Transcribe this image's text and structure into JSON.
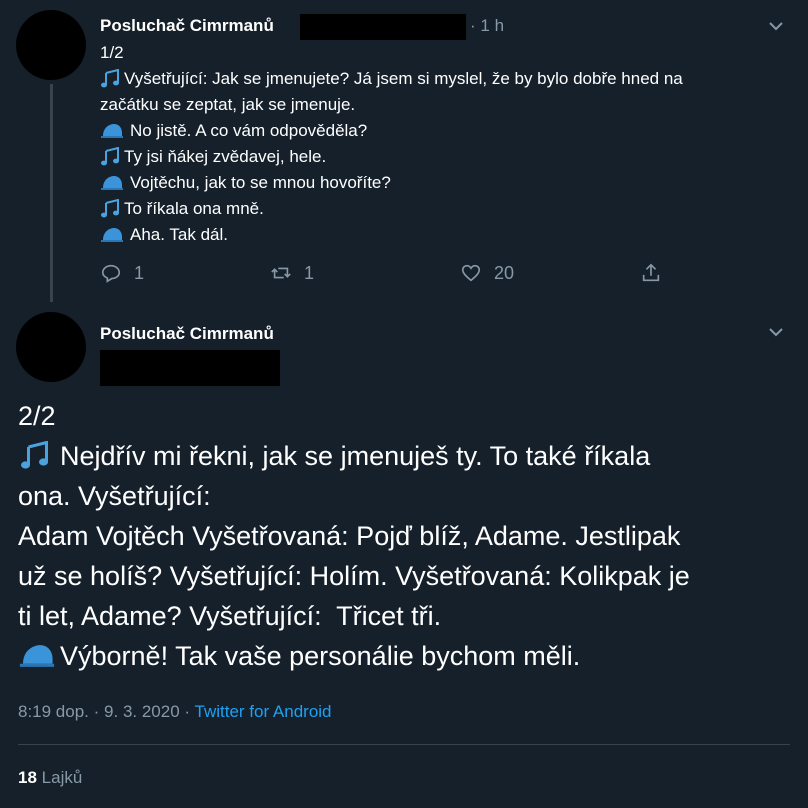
{
  "tweet1": {
    "author": "Posluchač Cimrmanů",
    "time": "1 h",
    "lines": [
      {
        "icon": "music-notes-icon",
        "text": "1/2"
      },
      {
        "icon": "music-notes-icon",
        "text": "Vyšetřující: Jak se jmenujete? Já jsem si myslel, že by bylo dobře hned na"
      },
      {
        "icon": "",
        "text": "začátku se zeptat, jak se jmenuje."
      },
      {
        "icon": "cap-icon",
        "text": " No jistě. A co vám odpověděla?"
      },
      {
        "icon": "music-notes-icon",
        "text": "Ty jsi ňákej zvědavej, hele."
      },
      {
        "icon": "cap-icon",
        "text": " Vojtěchu, jak to se mnou hovoříte?"
      },
      {
        "icon": "music-notes-icon",
        "text": "To říkala ona mně."
      },
      {
        "icon": "cap-icon",
        "text": "Aha. Tak dál."
      }
    ],
    "actions": {
      "reply_count": "1",
      "retweet_count": "1",
      "like_count": "20"
    }
  },
  "tweet2": {
    "author": "Posluchač Cimrmanů",
    "lines": [
      {
        "icon": "",
        "text": "2/2"
      },
      {
        "icon": "music-notes-icon",
        "text": "Nejdřív mi řekni, jak se jmenuješ ty. To také říkala"
      },
      {
        "icon": "",
        "text": "ona. Vyšetřující:"
      },
      {
        "icon": "",
        "text": "Adam Vojtěch Vyšetřovaná: Pojď blíž, Adame. Jestlipak"
      },
      {
        "icon": "",
        "text": "už se holíš? Vyšetřující: Holím. Vyšetřovaná: Kolikpak je"
      },
      {
        "icon": "",
        "text": "ti let, Adame? Vyšetřující:  Třicet tři."
      },
      {
        "icon": "cap-icon",
        "text": "Výborně! Tak vaše personálie bychom měli."
      }
    ],
    "meta": {
      "time": "8:19 dop.",
      "sep": "·",
      "date": "9. 3. 2020",
      "source": "Twitter for Android"
    },
    "likes": {
      "count": "18",
      "label": "Lajků"
    }
  }
}
